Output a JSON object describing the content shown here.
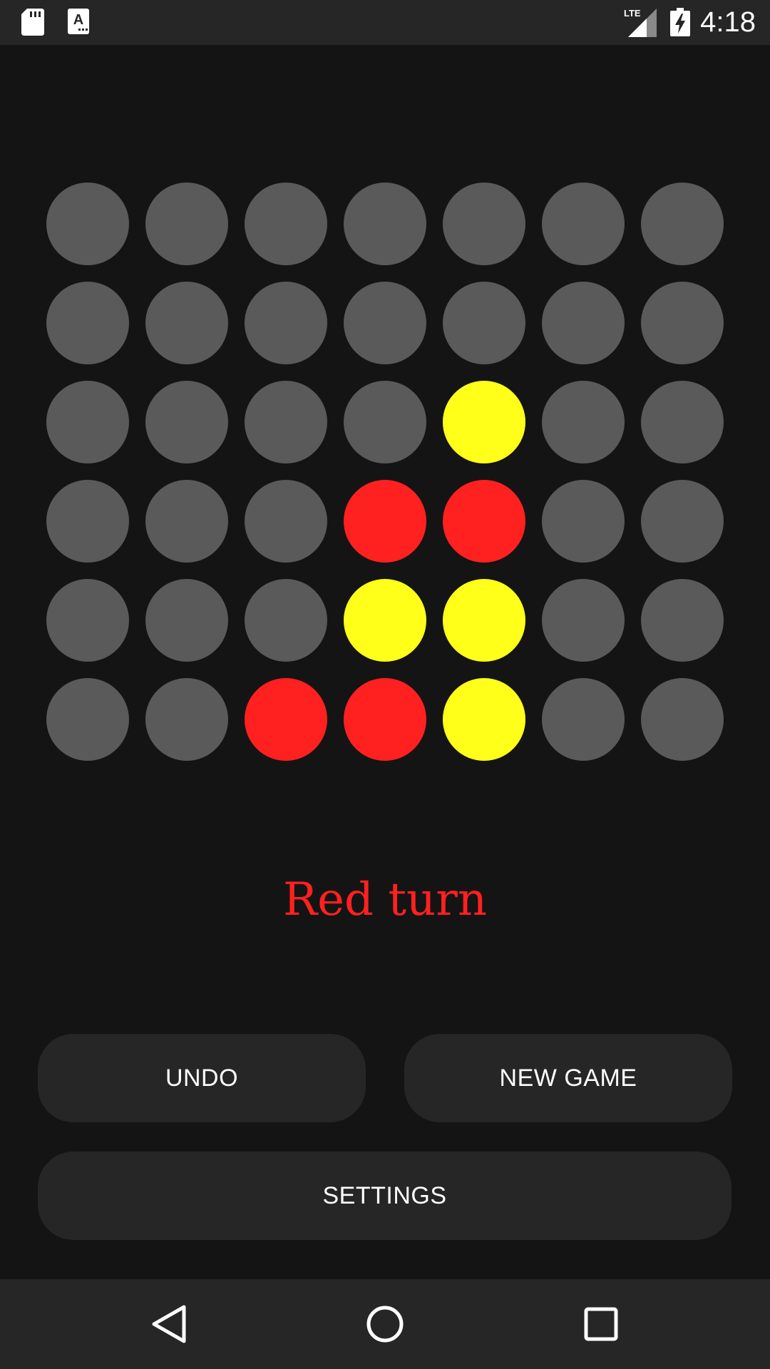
{
  "status_bar": {
    "time": "4:18",
    "network_label": "LTE",
    "icons": [
      "sd-card-icon",
      "keyboard-a-icon",
      "lte-signal-icon",
      "battery-charging-icon"
    ]
  },
  "board": {
    "rows": [
      [
        "empty",
        "empty",
        "empty",
        "empty",
        "empty",
        "empty",
        "empty"
      ],
      [
        "empty",
        "empty",
        "empty",
        "empty",
        "empty",
        "empty",
        "empty"
      ],
      [
        "empty",
        "empty",
        "empty",
        "empty",
        "yellow",
        "empty",
        "empty"
      ],
      [
        "empty",
        "empty",
        "empty",
        "red",
        "red",
        "empty",
        "empty"
      ],
      [
        "empty",
        "empty",
        "empty",
        "yellow",
        "yellow",
        "empty",
        "empty"
      ],
      [
        "empty",
        "empty",
        "red",
        "red",
        "yellow",
        "empty",
        "empty"
      ]
    ],
    "colors": {
      "empty": "#5a5a5a",
      "red": "#ff2020",
      "yellow": "#ffff1a"
    }
  },
  "game": {
    "turn_text": "Red turn"
  },
  "buttons": {
    "undo": "UNDO",
    "new_game": "NEW GAME",
    "settings": "SETTINGS"
  },
  "nav_bar": {
    "icons": [
      "back-icon",
      "home-icon",
      "recent-apps-icon"
    ]
  }
}
